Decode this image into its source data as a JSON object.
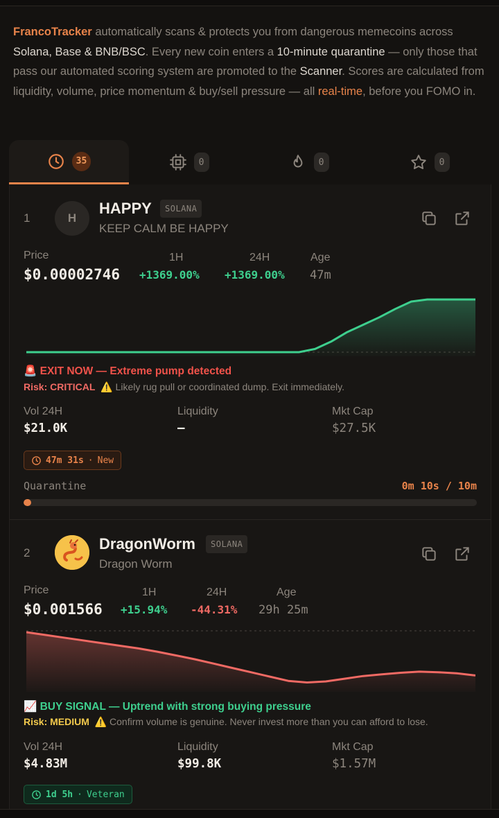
{
  "intro": {
    "brand": "FrancoTracker",
    "t1": " automatically scans & protects you from dangerous memecoins across ",
    "chains": "Solana, Base & BNB/BSC",
    "t2": ". Every new coin enters a ",
    "quarantine": "10-minute quarantine",
    "t3": " — only those that pass our automated scoring system are promoted to the ",
    "scanner": "Scanner",
    "t4": ". Scores are calculated from liquidity, volume, price momentum & buy/sell pressure — all ",
    "realtime": "real-time",
    "t5": ", before you FOMO in."
  },
  "tabs": [
    {
      "icon": "clock-icon",
      "count": "35",
      "active": true
    },
    {
      "icon": "chip-icon",
      "count": "0"
    },
    {
      "icon": "flame-icon",
      "count": "0"
    },
    {
      "icon": "star-icon",
      "count": "0"
    }
  ],
  "labels": {
    "price": "Price",
    "h1": "1H",
    "h24": "24H",
    "age": "Age",
    "vol": "Vol 24H",
    "liq": "Liquidity",
    "mcap": "Mkt Cap",
    "risk": "Risk:",
    "quarantine": "Quarantine"
  },
  "coins": [
    {
      "rank": "1",
      "avatar": "H",
      "symbol": "HAPPY",
      "chain": "SOLANA",
      "name": "KEEP CALM BE HAPPY",
      "price": "$0.00002746",
      "change_1h": "+1369.00%",
      "change_24h": "+1369.00%",
      "age": "47m",
      "signal": "🚨 EXIT NOW — Extreme pump detected",
      "risk_level": "CRITICAL",
      "risk_note": "⚠️ Likely rug pull or coordinated dump. Exit immediately.",
      "vol_24h": "$21.0K",
      "liquidity": "—",
      "mkt_cap": "$27.5K",
      "tag": "47m 31s",
      "tag_status": "New",
      "quarantine_time": "0m 10s / 10m",
      "quarantine_progress": 0.017,
      "sparkline": [
        0,
        0,
        0,
        0,
        0,
        0,
        0,
        0,
        0,
        0,
        0,
        0,
        0,
        0,
        0,
        0,
        0,
        0.0,
        0.06,
        0.2,
        0.38,
        0.52,
        0.66,
        0.82,
        0.96,
        1,
        1,
        1,
        1
      ],
      "color": "#3ecf8e"
    },
    {
      "rank": "2",
      "avatar": "dragon",
      "symbol": "DragonWorm",
      "chain": "SOLANA",
      "name": "Dragon Worm",
      "price": "$0.001566",
      "change_1h": "+15.94%",
      "change_24h": "-44.31%",
      "age": "29h 25m",
      "signal": "📈 BUY SIGNAL — Uptrend with strong buying pressure",
      "risk_level": "MEDIUM",
      "risk_note": "⚠️ Confirm volume is genuine. Never invest more than you can afford to lose.",
      "vol_24h": "$4.83M",
      "liquidity": "$99.8K",
      "mkt_cap": "$1.57M",
      "tag": "1d 5h",
      "tag_status": "Veteran",
      "sparkline": [
        1,
        0.95,
        0.9,
        0.85,
        0.8,
        0.75,
        0.7,
        0.64,
        0.57,
        0.5,
        0.42,
        0.34,
        0.26,
        0.18,
        0.1,
        0.07,
        0.09,
        0.14,
        0.19,
        0.22,
        0.25,
        0.27,
        0.26,
        0.24,
        0.2
      ],
      "color": "#f06a64"
    }
  ]
}
